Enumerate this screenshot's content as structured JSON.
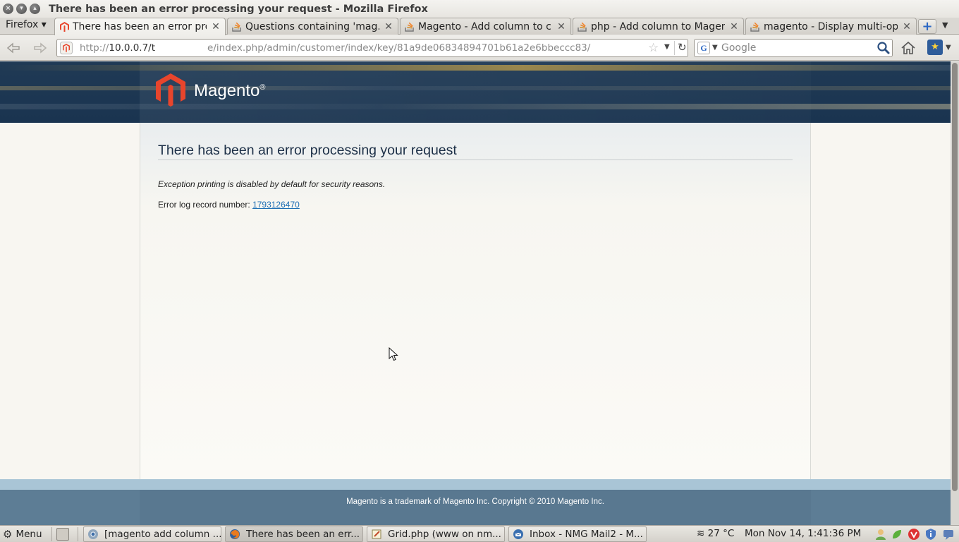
{
  "window": {
    "title": "There has been an error processing your request - Mozilla Firefox"
  },
  "browser": {
    "menu_label": "Firefox ▾",
    "tabs": [
      {
        "label": "There has been an error pro...",
        "icon": "magento-favicon"
      },
      {
        "label": "Questions containing 'mag...",
        "icon": "stackoverflow-favicon"
      },
      {
        "label": "Magento - Add column to c...",
        "icon": "stackoverflow-favicon"
      },
      {
        "label": "php - Add column to Magen...",
        "icon": "stackoverflow-favicon"
      },
      {
        "label": "magento - Display multi-op...",
        "icon": "stackoverflow-favicon"
      }
    ],
    "new_tab_label": "+",
    "url": {
      "prefix": "http://",
      "host": "10.0.0.7/t",
      "rest": "e/index.php/admin/customer/index/key/81a9de06834894701b61a2e6bbeccc83/"
    },
    "search_placeholder": "Google",
    "search_engine_letter": "G"
  },
  "page": {
    "logo_text": "Magento",
    "logo_reg": "®",
    "heading": "There has been an error processing your request",
    "message": "Exception printing is disabled by default for security reasons.",
    "error_log_label": "Error log record number: ",
    "error_log_number": "1793126470",
    "footer": "Magento is a trademark of Magento Inc. Copyright © 2010 Magento Inc.",
    "colors": {
      "header": "#1d3752",
      "accent": "#e8452c",
      "link": "#1e6fb4",
      "footer": "#5d7d95"
    }
  },
  "taskbar": {
    "menu_label": "Menu",
    "tasks": [
      {
        "label": "[magento add column ...",
        "icon": "chrome-icon"
      },
      {
        "label": "There has been an err...",
        "icon": "firefox-icon"
      },
      {
        "label": "Grid.php (www on nm...",
        "icon": "text-editor-icon"
      },
      {
        "label": "Inbox - NMG Mail2 - M...",
        "icon": "thunderbird-icon"
      }
    ],
    "weather": "27 °C",
    "clock": "Mon Nov 14,  1:41:36 PM"
  }
}
